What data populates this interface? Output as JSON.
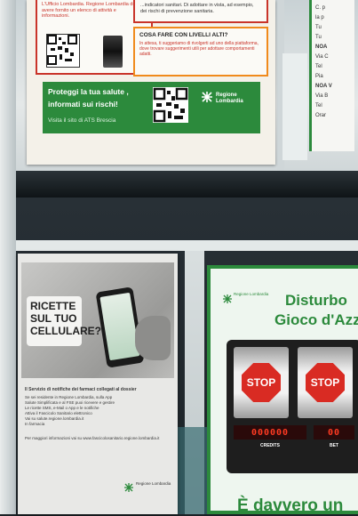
{
  "top_poster": {
    "box1_text": "L'Ufficio Lombardia. Regione Lombardia deve avere fornito un elenco di attività e informazioni.",
    "box2_text": "...indicatori sanitari. Di adottare in vista, ad esempio, dei rischi di prevenzione sanitaria.",
    "box3_title": "COSA FARE CON LIVELLI ALTI?",
    "box3_text": "In attesa, ti suggeriamo di rivolgerti ad uno della piattaforma, dove trovare suggerimenti utili per adottare comportamenti adatti.",
    "green_line1": "Proteggi la tua salute ,",
    "green_line2": "informati sui rischi!",
    "green_line3": "Visita il sito di ATS Brescia",
    "logo_name": "Regione Lombardia"
  },
  "right_edge_poster": {
    "lines": [
      "C. p",
      "la p",
      "Tu",
      "Tu",
      "NOA",
      "Via C",
      "Tel",
      "Pia",
      "NOA V",
      "Via B",
      "Tel",
      "Orar"
    ]
  },
  "left_poster": {
    "headline_line1": "RICETTE",
    "headline_line2": "SUL TUO",
    "headline_line3": "CELLULARE?",
    "intro": "Il Servizio di notifiche dei farmaci collegati al dossier",
    "bullets": [
      "Se sei residente in Regione Lombardia, sulla App",
      "Salute Simplificata e al FSE puoi ricevere e gestire",
      "Le ricette SMS, e-Mail o App e le notifiche",
      "Attiva il Fascicolo Sanitario elettronico",
      "Vai su salute.regione.lombardia.it",
      "In farmacia"
    ],
    "footer": "Per maggiori informazioni vai su www.fascicolosanitario.regione.lombardia.it",
    "logo_name": "Regione Lombardia"
  },
  "right_poster": {
    "logo_name": "Regione Lombardia",
    "title_line1": "Disturbo",
    "title_line2": "Gioco d'Azz",
    "reel1": "STOP",
    "reel2": "STOP",
    "counter1": "000000",
    "counter2": "00",
    "counter1_label": "CREDITS",
    "counter2_label": "BET",
    "bottom_text": "È davvero un"
  }
}
